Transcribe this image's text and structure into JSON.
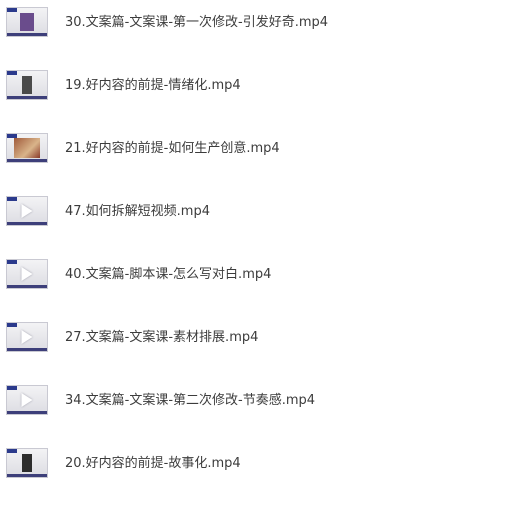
{
  "files": [
    {
      "name": "30.文案篇-文案课-第一次修改-引发好奇.mp4",
      "thumb_icon": "video-thumbnail-icon"
    },
    {
      "name": "19.好内容的前提-情绪化.mp4",
      "thumb_icon": "video-thumbnail-icon"
    },
    {
      "name": "21.好内容的前提-如何生产创意.mp4",
      "thumb_icon": "video-thumbnail-icon"
    },
    {
      "name": "47.如何拆解短视频.mp4",
      "thumb_icon": "video-thumbnail-icon"
    },
    {
      "name": "40.文案篇-脚本课-怎么写对白.mp4",
      "thumb_icon": "video-thumbnail-icon"
    },
    {
      "name": "27.文案篇-文案课-素材排展.mp4",
      "thumb_icon": "video-thumbnail-icon"
    },
    {
      "name": "34.文案篇-文案课-第二次修改-节奏感.mp4",
      "thumb_icon": "video-thumbnail-icon"
    },
    {
      "name": "20.好内容的前提-故事化.mp4",
      "thumb_icon": "video-thumbnail-icon"
    }
  ],
  "colors": {
    "text": "#3c3c3c",
    "background": "#ffffff",
    "thumb_accent": "#2b3a8c"
  }
}
